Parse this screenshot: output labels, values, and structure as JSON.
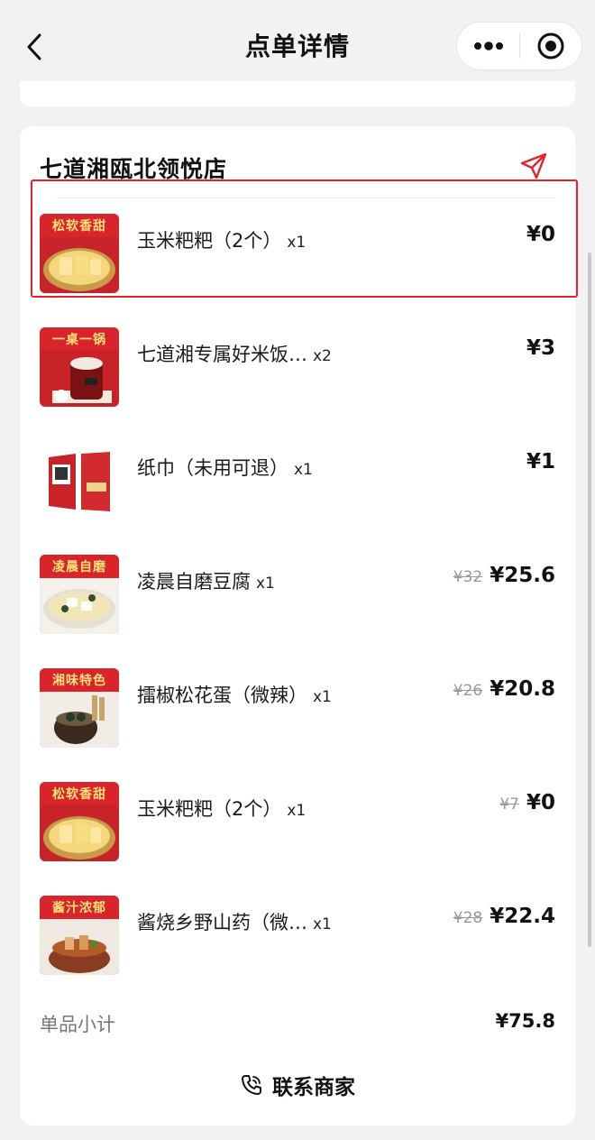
{
  "header": {
    "title": "点单详情",
    "back_icon": "chevron-left-icon",
    "more_icon": "more-dots-icon",
    "close_icon": "target-circle-icon"
  },
  "store": {
    "name": "七道湘瓯北领悦店",
    "nav_icon": "navigation-arrow-icon"
  },
  "items": [
    {
      "name": "玉米粑粑（2个）",
      "qty": "x1",
      "original_price": "",
      "price": "¥0",
      "thumb_label": "松软香甜",
      "highlighted": true
    },
    {
      "name": "七道湘专属好米饭…",
      "qty": "x2",
      "original_price": "",
      "price": "¥3",
      "thumb_label": "一桌一锅"
    },
    {
      "name": "纸巾（未用可退）",
      "qty": "x1",
      "original_price": "",
      "price": "¥1",
      "thumb_label": ""
    },
    {
      "name": "凌晨自磨豆腐",
      "qty": "x1",
      "original_price": "¥32",
      "price": "¥25.6",
      "thumb_label": "凌晨自磨"
    },
    {
      "name": "擂椒松花蛋（微辣）",
      "qty": "x1",
      "original_price": "¥26",
      "price": "¥20.8",
      "thumb_label": "湘味特色"
    },
    {
      "name": "玉米粑粑（2个）",
      "qty": "x1",
      "original_price": "¥7",
      "price": "¥0",
      "thumb_label": "松软香甜"
    },
    {
      "name": "酱烧乡野山药（微…",
      "qty": "x1",
      "original_price": "¥28",
      "price": "¥22.4",
      "thumb_label": "酱汁浓郁"
    }
  ],
  "subtotal": {
    "label": "单品小计",
    "value": "¥75.8"
  },
  "contact": {
    "label": "联系商家",
    "icon": "phone-icon"
  },
  "colors": {
    "accent_red": "#e3222b",
    "background": "#f2f2f2",
    "card": "#ffffff"
  }
}
